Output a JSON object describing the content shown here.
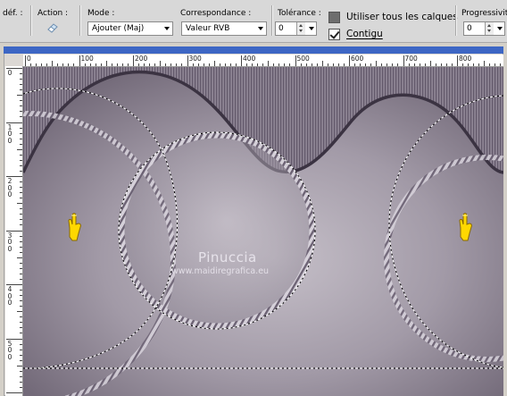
{
  "toolbar": {
    "def_label": "déf. :",
    "action_label": "Action :",
    "mode_label": "Mode :",
    "mode_value": "Ajouter (Maj)",
    "match_label": "Correspondance :",
    "match_value": "Valeur RVB",
    "tolerance_label": "Tolérance :",
    "tolerance_value": "0",
    "use_all_layers_label": "Utiliser tous les calques",
    "use_all_layers_checked": false,
    "contiguous_label": "Contigu",
    "contiguous_checked": true,
    "progressivity_label": "Progressivité",
    "progressivity_value": "0"
  },
  "ruler": {
    "top_labels": [
      "0",
      "100",
      "200",
      "300",
      "400",
      "500",
      "600",
      "700",
      "800"
    ],
    "left_labels": [
      [
        "0"
      ],
      [
        "1",
        "0",
        "0"
      ],
      [
        "2",
        "0",
        "0"
      ],
      [
        "3",
        "0",
        "0"
      ],
      [
        "4",
        "0",
        "0"
      ],
      [
        "5",
        "0",
        "0"
      ]
    ]
  },
  "watermark": {
    "title": "Pinuccia",
    "url": "www.maidiregrafica.eu"
  },
  "colors": {
    "canvas_light": "#c3bcc6",
    "canvas_mid": "#9d95a2",
    "canvas_dark": "#5a5060",
    "title_bar": "#3d66c4",
    "cursor_yellow": "#ffd800"
  },
  "cursors": [
    "pointing-hand-icon",
    "pointing-hand-icon"
  ]
}
